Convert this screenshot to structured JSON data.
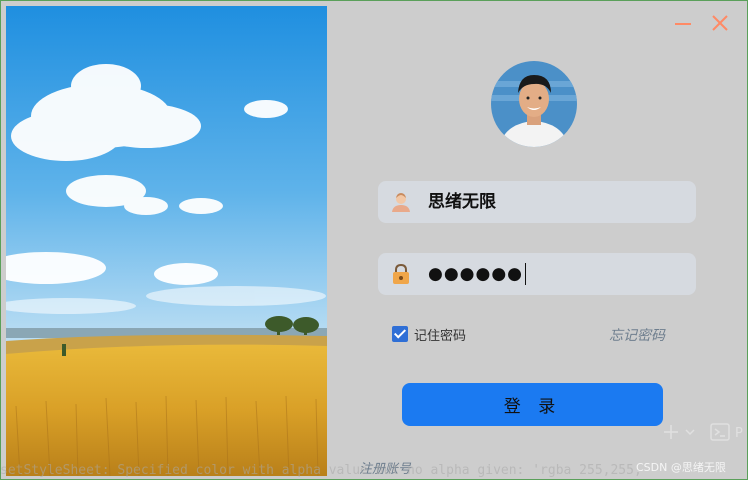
{
  "window": {
    "minimize_icon": "minimize-icon",
    "close_icon": "close-icon",
    "accent": "#ff8a65"
  },
  "scene": {
    "description_icon": "landscape-image"
  },
  "login": {
    "username": "思绪无限",
    "password_masked": "●●●●●●",
    "remember_label": "记住密码",
    "remember_checked": true,
    "forgot_label": "忘记密码",
    "login_label": "登 录",
    "register_label": "注册账号"
  },
  "colors": {
    "primary": "#1b7af1",
    "field_bg": "#d6dae0",
    "link": "#6e7e8e"
  },
  "ide": {
    "console_text": "setStyleSheet: Specified color with alpha value but no alpha given: 'rgba 255,255,",
    "plus_icon": "plus-icon",
    "terminal_icon": "terminal-icon",
    "terminal_label": "P"
  },
  "watermark": "CSDN @思绪无限"
}
